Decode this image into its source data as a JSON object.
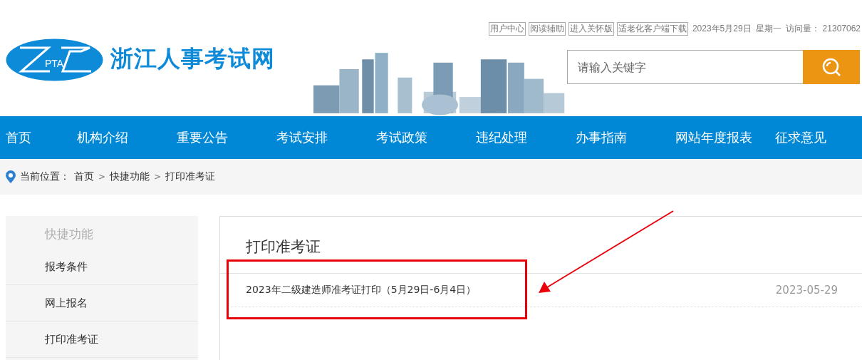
{
  "top_links": [
    "用户中心",
    "阅读辅助",
    "进入关怀版",
    "适老化客户端下载"
  ],
  "date": "2023年5月29日",
  "weekday": "星期一",
  "visits_label": "访问量：",
  "visits": "21307062",
  "logo": {
    "text": "PTA"
  },
  "site_title": "浙江人事考试网",
  "search": {
    "placeholder": "请输入关键字"
  },
  "nav": [
    "首页",
    "机构介绍",
    "重要公告",
    "考试安排",
    "考试政策",
    "违纪处理",
    "办事指南",
    "网站年度报表",
    "征求意见"
  ],
  "breadcrumb": {
    "label": "当前位置：",
    "items": [
      {
        "kind": "link",
        "text": "首页"
      },
      {
        "kind": "separator",
        "text": ">"
      },
      {
        "kind": "link",
        "text": "快捷功能"
      },
      {
        "kind": "separator",
        "text": ">"
      },
      {
        "kind": "link",
        "text": "打印准考证"
      }
    ]
  },
  "sidebar": {
    "title": "快捷功能",
    "items": [
      "报考条件",
      "网上报名",
      "打印准考证"
    ]
  },
  "panel": {
    "title": "打印准考证",
    "items": [
      {
        "title": "2023年二级建造师准考证打印（5月29日-6月4日）",
        "date": "2023-05-29"
      }
    ]
  },
  "annotations": {
    "frame": true,
    "arrow": true
  }
}
